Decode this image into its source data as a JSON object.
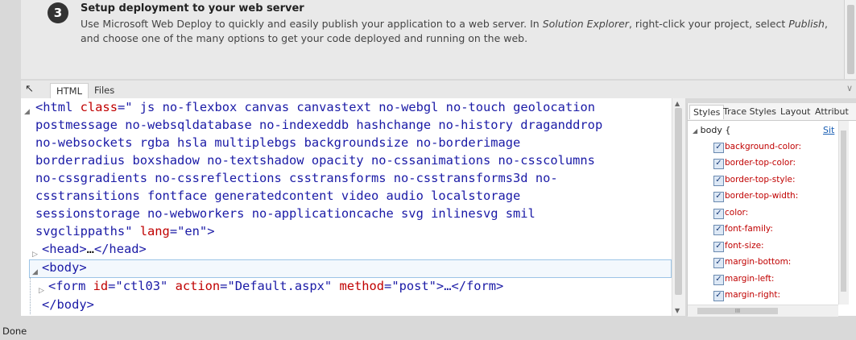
{
  "step": {
    "number": "3",
    "title": "Setup deployment to your web server",
    "desc_part1": "Use Microsoft Web Deploy to quickly and easily publish your application to a web server. In ",
    "desc_em1": "Solution Explorer",
    "desc_part2": ", right-click your project, select ",
    "desc_em2": "Publish",
    "desc_part3": ", and choose one of the many options to get your code deployed and running on the web."
  },
  "devtools": {
    "tabs": [
      "HTML",
      "Files"
    ],
    "tree": {
      "html_open": "<html",
      "class_attr": "class",
      "eq1": "=\"",
      "class_line1": " js no-flexbox canvas canvastext no-webgl no-touch geolocation",
      "class_line2": "postmessage no-websqldatabase no-indexeddb hashchange no-history draganddrop",
      "class_line3": "no-websockets rgba hsla multiplebgs backgroundsize no-borderimage",
      "class_line4": "borderradius boxshadow no-textshadow opacity no-cssanimations no-csscolumns",
      "class_line5": "no-cssgradients no-cssreflections csstransforms no-csstransforms3d no-",
      "class_line6": "csstransitions fontface generatedcontent video audio localstorage",
      "class_line7": "sessionstorage no-webworkers no-applicationcache svg inlinesvg smil",
      "class_line8_end": "svgclippaths\"",
      "lang_attr": "lang",
      "lang_eq": "=",
      "lang_val": "\"en\"",
      "gt": ">",
      "head_open": "<head>",
      "head_ellipsis": "…",
      "head_close": "</head>",
      "body_open": "<body>",
      "form_open": "<form ",
      "form_id_attr": "id",
      "form_id_val": "=\"ctl03\"",
      "form_action_attr": " action",
      "form_action_val": "=\"Default.aspx\"",
      "form_method_attr": " method",
      "form_method_val": "=\"post\"",
      "form_rest": ">…</form>",
      "body_close": "</body>"
    },
    "styles_tabs": [
      "Styles",
      "Trace Styles",
      "Layout",
      "Attribut"
    ],
    "rule_selector": "body {",
    "rule_link": "Sit",
    "properties": [
      "background-color:",
      "border-top-color:",
      "border-top-style:",
      "border-top-width:",
      "color:",
      "font-family:",
      "font-size:",
      "margin-bottom:",
      "margin-left:",
      "margin-right:"
    ],
    "hscroll_grip": "III"
  },
  "status_text": "Done",
  "colors": {
    "tag": "#1a1aa6",
    "attribute": "#c00000",
    "value": "#1a1aa6"
  }
}
